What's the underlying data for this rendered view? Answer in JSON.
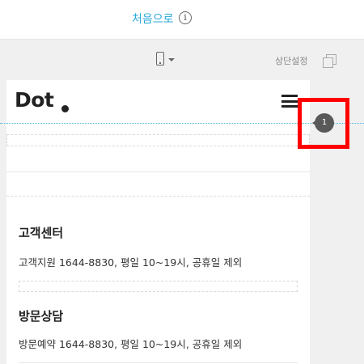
{
  "topbar": {
    "home_label": "처음으로",
    "info_icon": "info-icon",
    "info_glyph": "i"
  },
  "toolbar": {
    "device_icon": "mobile-device-icon",
    "device_dropdown_icon": "caret-down-icon",
    "fixed_top_label": "상단설정",
    "copy_icon": "copy-icon"
  },
  "preview": {
    "logo_text": "Dot",
    "menu_icon": "hamburger-menu-icon",
    "sections": [
      {
        "title": "고객센터",
        "text": "고객지원 1644-8830,  평일 10~19시, 공휴일 제외"
      },
      {
        "title": "방문상담",
        "text": "방문예약 1644-8830,  평일 10~19시, 공휴일 제외"
      }
    ]
  },
  "marker": {
    "number": "1"
  },
  "colors": {
    "accent": "#29a8d8",
    "highlight": "#ff0000",
    "marker": "#595959"
  }
}
